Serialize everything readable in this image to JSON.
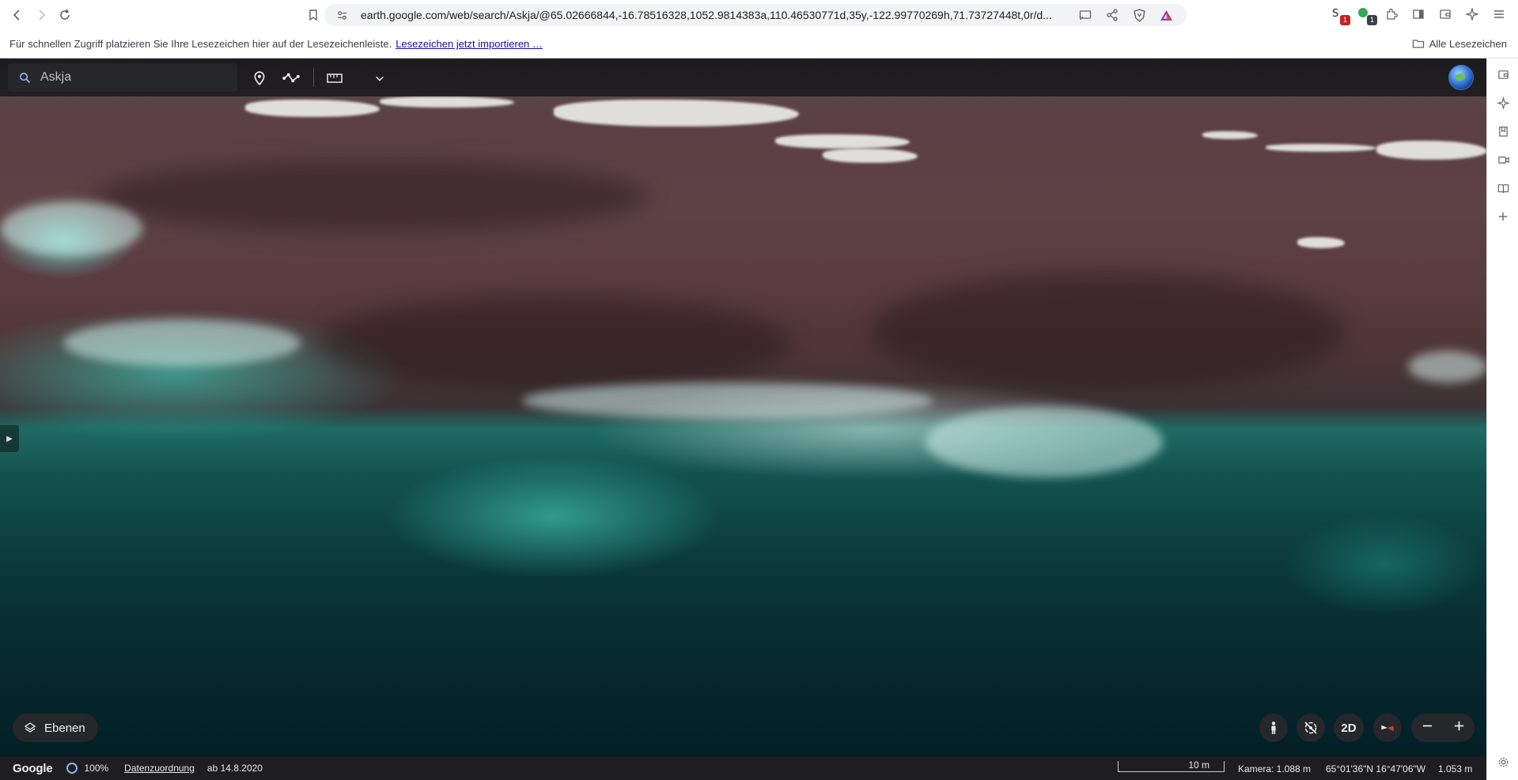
{
  "browser": {
    "url": "earth.google.com/web/search/Askja/@65.02666844,-16.78516328,1052.9814383a,110.46530771d,35y,-122.99770269h,71.73727448t,0r/d...",
    "ext_badge_1": "1",
    "ext_badge_2": "1"
  },
  "bookmarks_bar": {
    "prompt": "Für schnellen Zugriff platzieren Sie Ihre Lesezeichen hier auf der Lesezeichenleiste.",
    "import_link": "Lesezeichen jetzt importieren …",
    "all_bookmarks": "Alle Lesezeichen"
  },
  "earth_toolbar": {
    "search_value": "Askja"
  },
  "controls": {
    "layers_label": "Ebenen",
    "mode_2d": "2D"
  },
  "status": {
    "logo": "Google",
    "loading": "100%",
    "attribution": "Datenzuordnung",
    "imagery_date": "ab 14.8.2020",
    "scale_label": "10 m",
    "camera": "Kamera: 1.088 m",
    "coordinates": "65°01'36\"N 16°47'06\"W",
    "altitude": "1.053 m"
  },
  "colors": {
    "toolbar_bg": "#18181a",
    "accent": "#8ab4f8",
    "link": "#1a0dab"
  }
}
